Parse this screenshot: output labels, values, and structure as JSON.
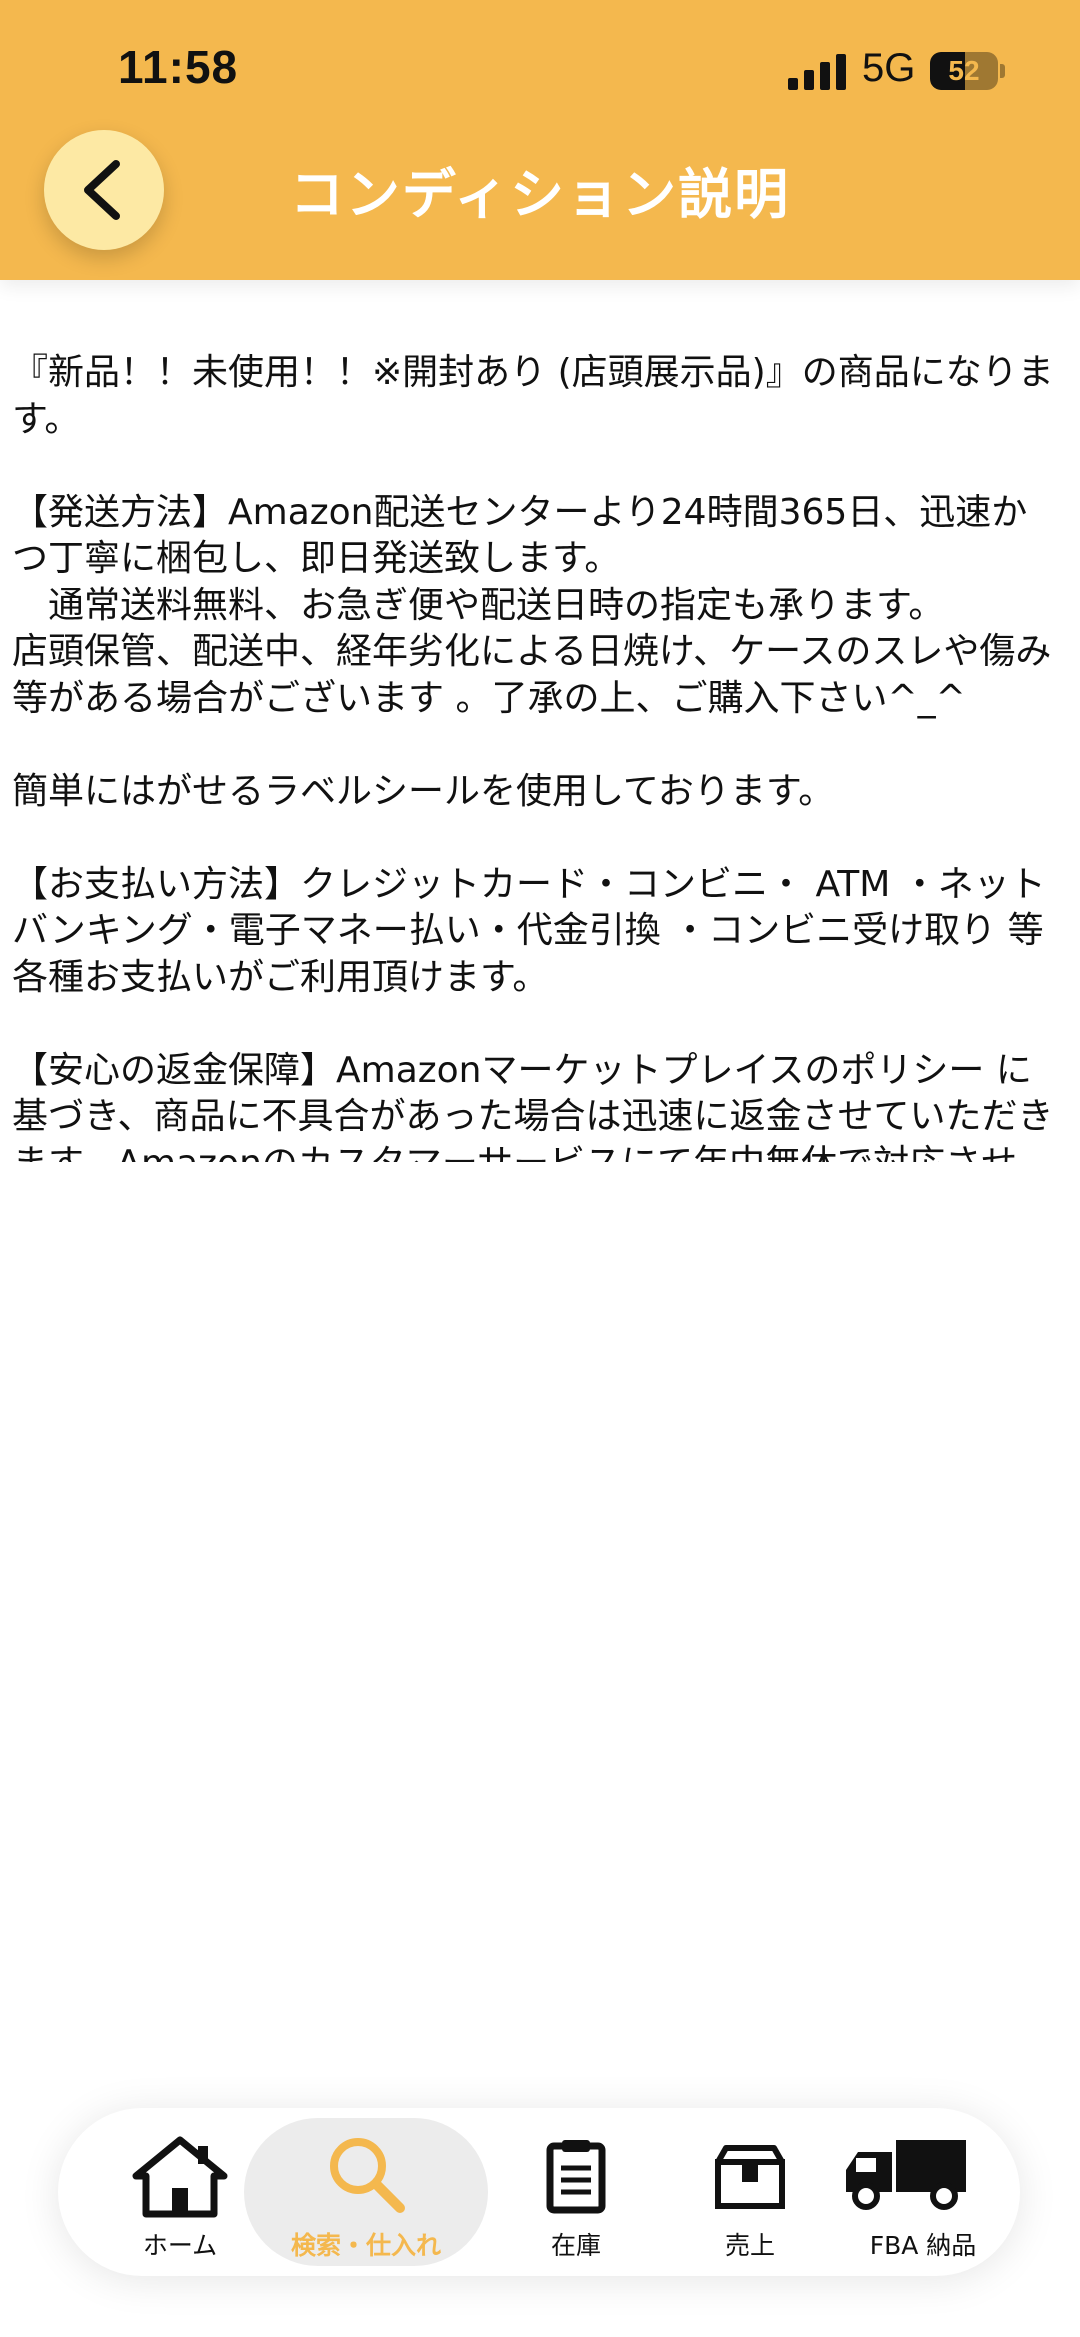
{
  "status_bar": {
    "time": "11:58",
    "network": "5G",
    "battery": "52",
    "battery_level": 0.52
  },
  "header": {
    "title": "コンディション説明",
    "back_icon": "chevron-left-icon",
    "color": "#f4b84e"
  },
  "content": {
    "paragraphs": [
      "『新品！！未使用！！※開封あり (店頭展示品)』の商品になります。",
      "",
      "【発送方法】Amazon配送センターより24時間365日、迅速かつ丁寧に梱包し、即日発送致します。",
      "　通常送料無料、お急ぎ便や配送日時の指定も承ります。",
      "店頭保管、配送中、経年劣化による日焼け、ケースのスレや傷み等がある場合がございます 。了承の上、ご購入下さい^_^",
      "",
      "簡単にはがせるラベルシールを使用しております。",
      "",
      "【お支払い方法】クレジットカード・コンビニ・ ATM ・ネットバンキング・電子マネー払い・代金引換 ・コンビニ受け取り 等各種お支払いがご利用頂けます。",
      "",
      "【安心の返金保障】Amazonマーケットプレイスのポリシー に基づき、商品に不具合があった場合は迅速に返金させていただきます。Amazonのカスタマーサービスにて年中無休で対応させ"
    ]
  },
  "tabbar": {
    "active_index": 1,
    "active_color": "#f4b84e",
    "items": [
      {
        "label": "ホーム",
        "icon": "home-icon"
      },
      {
        "label": "検索・仕入れ",
        "icon": "search-icon"
      },
      {
        "label": "在庫",
        "icon": "clipboard-icon"
      },
      {
        "label": "売上",
        "icon": "box-icon"
      },
      {
        "label": "FBA 納品",
        "icon": "truck-icon"
      }
    ]
  }
}
